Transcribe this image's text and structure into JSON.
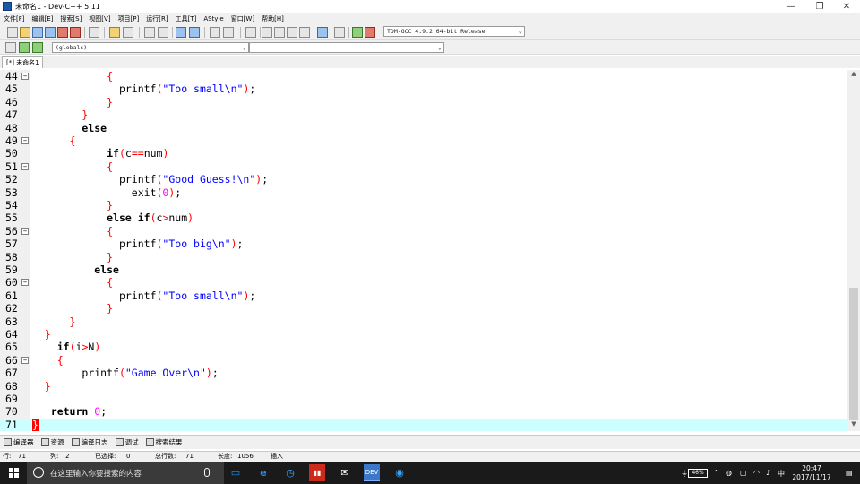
{
  "window": {
    "title": "未命名1 - Dev-C++ 5.11",
    "minimize": "—",
    "maximize": "❐",
    "close": "✕"
  },
  "menu": [
    "文件[F]",
    "编辑[E]",
    "搜索[S]",
    "视图[V]",
    "项目[P]",
    "运行[R]",
    "工具[T]",
    "AStyle",
    "窗口[W]",
    "帮助[H]"
  ],
  "toolbar": {
    "compiler": "TDM-GCC 4.9.2 64-bit Release",
    "scope": "(globals)",
    "member": ""
  },
  "tab": {
    "label": "[*] 未命名1"
  },
  "editor": {
    "lines": [
      {
        "n": "44",
        "fold": true,
        "indent": "            ",
        "tokens": [
          [
            "p",
            "{"
          ]
        ]
      },
      {
        "n": "45",
        "fold": false,
        "indent": "              ",
        "tokens": [
          [
            "pl",
            "printf"
          ],
          [
            "p",
            "("
          ],
          [
            "s",
            "\"Too small\\n\""
          ],
          [
            "p",
            ")"
          ],
          [
            "pl",
            ";"
          ]
        ]
      },
      {
        "n": "46",
        "fold": false,
        "indent": "            ",
        "tokens": [
          [
            "p",
            "}"
          ]
        ]
      },
      {
        "n": "47",
        "fold": false,
        "indent": "        ",
        "tokens": [
          [
            "p",
            "}"
          ]
        ]
      },
      {
        "n": "48",
        "fold": false,
        "indent": "        ",
        "tokens": [
          [
            "k",
            "else"
          ]
        ]
      },
      {
        "n": "49",
        "fold": true,
        "indent": "      ",
        "tokens": [
          [
            "p",
            "{"
          ]
        ]
      },
      {
        "n": "50",
        "fold": false,
        "indent": "            ",
        "tokens": [
          [
            "k",
            "if"
          ],
          [
            "p",
            "("
          ],
          [
            "pl",
            "c"
          ],
          [
            "p",
            "=="
          ],
          [
            "pl",
            "num"
          ],
          [
            "p",
            ")"
          ]
        ]
      },
      {
        "n": "51",
        "fold": true,
        "indent": "            ",
        "tokens": [
          [
            "p",
            "{"
          ]
        ]
      },
      {
        "n": "52",
        "fold": false,
        "indent": "              ",
        "tokens": [
          [
            "pl",
            "printf"
          ],
          [
            "p",
            "("
          ],
          [
            "s",
            "\"Good Guess!\\n\""
          ],
          [
            "p",
            ")"
          ],
          [
            "pl",
            ";"
          ]
        ]
      },
      {
        "n": "53",
        "fold": false,
        "indent": "                ",
        "tokens": [
          [
            "pl",
            "exit"
          ],
          [
            "p",
            "("
          ],
          [
            "n",
            "0"
          ],
          [
            "p",
            ")"
          ],
          [
            "pl",
            ";"
          ]
        ]
      },
      {
        "n": "54",
        "fold": false,
        "indent": "            ",
        "tokens": [
          [
            "p",
            "}"
          ]
        ]
      },
      {
        "n": "55",
        "fold": false,
        "indent": "            ",
        "tokens": [
          [
            "k",
            "else if"
          ],
          [
            "p",
            "("
          ],
          [
            "pl",
            "c"
          ],
          [
            "p",
            ">"
          ],
          [
            "pl",
            "num"
          ],
          [
            "p",
            ")"
          ]
        ]
      },
      {
        "n": "56",
        "fold": true,
        "indent": "            ",
        "tokens": [
          [
            "p",
            "{"
          ]
        ]
      },
      {
        "n": "57",
        "fold": false,
        "indent": "              ",
        "tokens": [
          [
            "pl",
            "printf"
          ],
          [
            "p",
            "("
          ],
          [
            "s",
            "\"Too big\\n\""
          ],
          [
            "p",
            ")"
          ],
          [
            "pl",
            ";"
          ]
        ]
      },
      {
        "n": "58",
        "fold": false,
        "indent": "            ",
        "tokens": [
          [
            "p",
            "}"
          ]
        ]
      },
      {
        "n": "59",
        "fold": false,
        "indent": "          ",
        "tokens": [
          [
            "k",
            "else"
          ]
        ]
      },
      {
        "n": "60",
        "fold": true,
        "indent": "            ",
        "tokens": [
          [
            "p",
            "{"
          ]
        ]
      },
      {
        "n": "61",
        "fold": false,
        "indent": "              ",
        "tokens": [
          [
            "pl",
            "printf"
          ],
          [
            "p",
            "("
          ],
          [
            "s",
            "\"Too small\\n\""
          ],
          [
            "p",
            ")"
          ],
          [
            "pl",
            ";"
          ]
        ]
      },
      {
        "n": "62",
        "fold": false,
        "indent": "            ",
        "tokens": [
          [
            "p",
            "}"
          ]
        ]
      },
      {
        "n": "63",
        "fold": false,
        "indent": "      ",
        "tokens": [
          [
            "p",
            "}"
          ]
        ]
      },
      {
        "n": "64",
        "fold": false,
        "indent": "  ",
        "tokens": [
          [
            "p",
            "}"
          ]
        ]
      },
      {
        "n": "65",
        "fold": false,
        "indent": "    ",
        "tokens": [
          [
            "k",
            "if"
          ],
          [
            "p",
            "("
          ],
          [
            "pl",
            "i"
          ],
          [
            "p",
            ">"
          ],
          [
            "pl",
            "N"
          ],
          [
            "p",
            ")"
          ]
        ]
      },
      {
        "n": "66",
        "fold": true,
        "indent": "    ",
        "tokens": [
          [
            "p",
            "{"
          ]
        ]
      },
      {
        "n": "67",
        "fold": false,
        "indent": "        ",
        "tokens": [
          [
            "pl",
            "printf"
          ],
          [
            "p",
            "("
          ],
          [
            "s",
            "\"Game Over\\n\""
          ],
          [
            "p",
            ")"
          ],
          [
            "pl",
            ";"
          ]
        ]
      },
      {
        "n": "68",
        "fold": false,
        "indent": "  ",
        "tokens": [
          [
            "p",
            "}"
          ]
        ]
      },
      {
        "n": "69",
        "fold": false,
        "indent": "",
        "tokens": []
      },
      {
        "n": "70",
        "fold": false,
        "indent": "   ",
        "tokens": [
          [
            "k",
            "return"
          ],
          [
            "pl",
            " "
          ],
          [
            "n",
            "0"
          ],
          [
            "pl",
            ";"
          ]
        ]
      },
      {
        "n": "71",
        "fold": false,
        "indent": "",
        "tokens": [
          [
            "caret",
            "}"
          ]
        ],
        "current": true
      }
    ]
  },
  "bottom_tabs": [
    "编译器",
    "资源",
    "编译日志",
    "调试",
    "搜索结果"
  ],
  "status": {
    "row_label": "行:",
    "row": "71",
    "col_label": "列:",
    "col": "2",
    "sel_label": "已选择:",
    "sel": "0",
    "total_label": "总行数:",
    "total": "71",
    "len_label": "长度:",
    "len": "1056",
    "mode": "插入"
  },
  "taskbar": {
    "search_placeholder": "在这里输入你要搜索的内容",
    "battery": "46%",
    "ime": "中",
    "time": "20:47",
    "date": "2017/11/17"
  }
}
